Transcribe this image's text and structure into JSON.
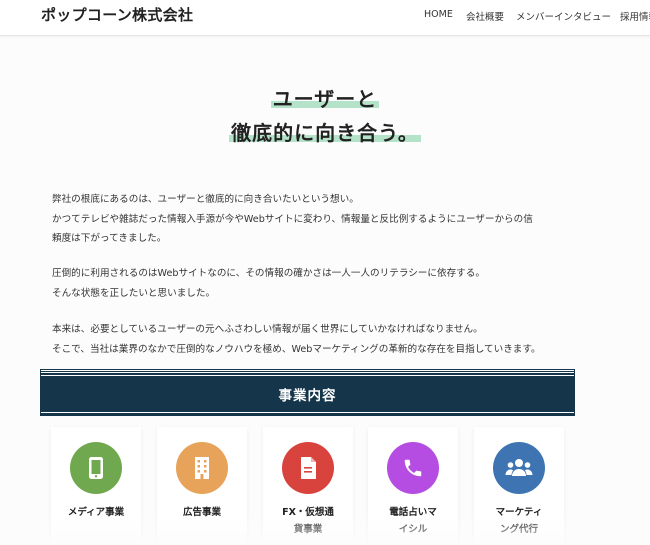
{
  "header": {
    "logo": "ポップコーン株式会社",
    "nav": [
      "HOME",
      "会社概要",
      "メンバーインタビュー",
      "採用情報"
    ]
  },
  "hero": {
    "line1": "ユーザーと",
    "line2": "徹底的に向き合う。",
    "highlight_color": "#b5e3c9"
  },
  "intro": {
    "block1": [
      "弊社の根底にあるのは、ユーザーと徹底的に向き合いたいという想い。",
      "かつてテレビや雑誌だった情報入手源が今やWebサイトに変わり、情報量と反比例するようにユーザーからの信",
      "頼度は下がってきました。"
    ],
    "block2": [
      "圧倒的に利用されるのはWebサイトなのに、その情報の確かさは一人一人のリテラシーに依存する。",
      "そんな状態を正したいと思いました。"
    ],
    "block3": [
      "本来は、必要としているユーザーの元へふさわしい情報が届く世界にしていかなければなりません。",
      "そこで、当社は業界のなかで圧倒的なノウハウを極め、Webマーケティングの革新的な存在を目指していきます。"
    ]
  },
  "services": {
    "title": "事業内容",
    "band_color": "#14354a",
    "items": [
      {
        "label": "メディア事業",
        "icon": "smartphone-icon",
        "color": "#6fa84f"
      },
      {
        "label": "広告事業",
        "icon": "building-icon",
        "color": "#e8a35a"
      },
      {
        "label": "FX・仮想通貨事業",
        "icon": "document-icon",
        "color": "#d9433e"
      },
      {
        "label": "電話占いマイシル",
        "icon": "phone-icon",
        "color": "#b54de2"
      },
      {
        "label": "マーケティング代行",
        "icon": "users-icon",
        "color": "#3f74b3"
      }
    ]
  }
}
